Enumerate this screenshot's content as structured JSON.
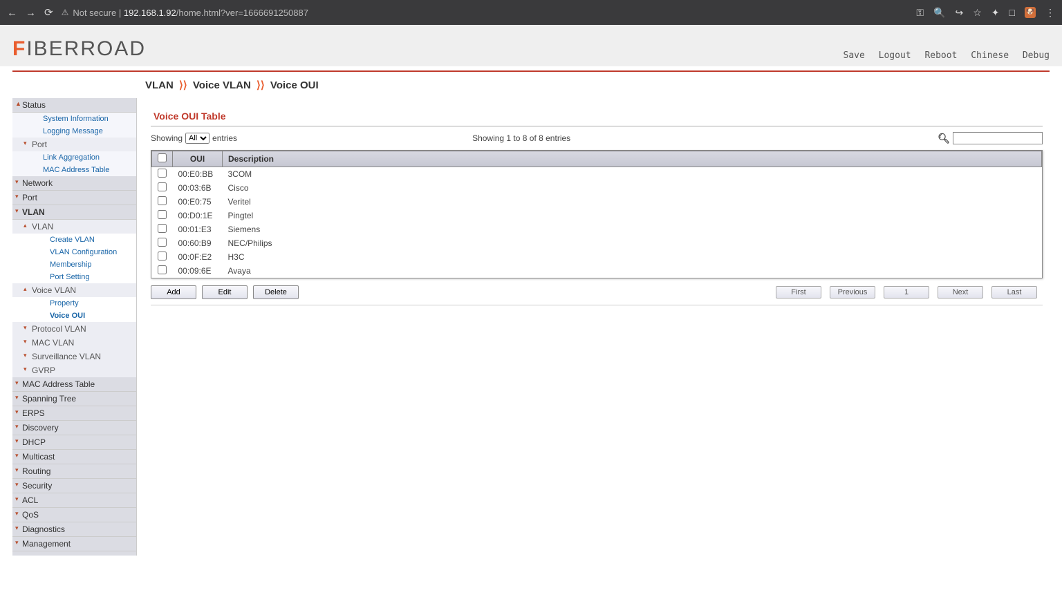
{
  "browser": {
    "not_secure": "Not secure",
    "url_host": "192.168.1.92",
    "url_path": "/home.html?ver=1666691250887"
  },
  "brand": {
    "first": "F",
    "rest": "IBERROAD"
  },
  "toplinks": {
    "save": "Save",
    "logout": "Logout",
    "reboot": "Reboot",
    "chinese": "Chinese",
    "debug": "Debug"
  },
  "breadcrumb": {
    "a": "VLAN",
    "b": "Voice VLAN",
    "c": "Voice OUI"
  },
  "sidebar": {
    "status": "Status",
    "sysinfo": "System Information",
    "logmsg": "Logging Message",
    "port": "Port",
    "linkagg": "Link Aggregation",
    "mactable": "MAC Address Table",
    "network": "Network",
    "port2": "Port",
    "vlan": "VLAN",
    "vlan_vlan": "VLAN",
    "create_vlan": "Create VLAN",
    "vlan_config": "VLAN Configuration",
    "membership": "Membership",
    "portsetting": "Port Setting",
    "voicevlan": "Voice VLAN",
    "property": "Property",
    "voiceoui": "Voice OUI",
    "protovlan": "Protocol VLAN",
    "macvlan": "MAC VLAN",
    "survvlan": "Surveillance VLAN",
    "gvrp": "GVRP",
    "macaddr": "MAC Address Table",
    "spanning": "Spanning Tree",
    "erps": "ERPS",
    "discovery": "Discovery",
    "dhcp": "DHCP",
    "multicast": "Multicast",
    "routing": "Routing",
    "security": "Security",
    "acl": "ACL",
    "qos": "QoS",
    "diag": "Diagnostics",
    "mgmt": "Management"
  },
  "section_title": "Voice OUI Table",
  "listctrl": {
    "showing_pre": "Showing",
    "showing_post": "entries",
    "select_value": "All",
    "range": "Showing 1 to 8 of 8 entries"
  },
  "columns": {
    "oui": "OUI",
    "desc": "Description"
  },
  "rows": [
    {
      "oui": "00:E0:BB",
      "desc": "3COM"
    },
    {
      "oui": "00:03:6B",
      "desc": "Cisco"
    },
    {
      "oui": "00:E0:75",
      "desc": "Veritel"
    },
    {
      "oui": "00:D0:1E",
      "desc": "Pingtel"
    },
    {
      "oui": "00:01:E3",
      "desc": "Siemens"
    },
    {
      "oui": "00:60:B9",
      "desc": "NEC/Philips"
    },
    {
      "oui": "00:0F:E2",
      "desc": "H3C"
    },
    {
      "oui": "00:09:6E",
      "desc": "Avaya"
    }
  ],
  "buttons": {
    "add": "Add",
    "edit": "Edit",
    "delete": "Delete"
  },
  "pager": {
    "first": "First",
    "prev": "Previous",
    "page": "1",
    "next": "Next",
    "last": "Last"
  }
}
